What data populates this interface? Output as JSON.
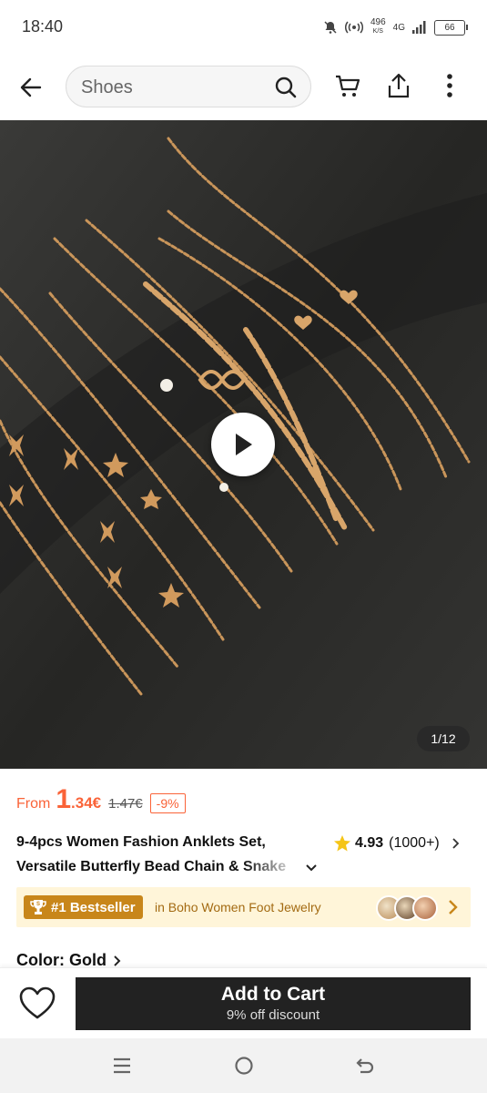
{
  "status_bar": {
    "time": "18:40",
    "net_speed_value": "496",
    "net_speed_unit": "K/S",
    "network": "4G",
    "battery": "66"
  },
  "header": {
    "search_placeholder": "Shoes"
  },
  "gallery": {
    "counter": "1/12"
  },
  "price": {
    "from_label": "From",
    "integer": "1",
    "decimal": ".34€",
    "original": "1.47€",
    "discount": "-9%"
  },
  "product": {
    "title_line1": "9-4pcs Women Fashion Anklets Set,",
    "title_line2": "Versatile Butterfly Bead Chain & Snake",
    "rating": "4.93",
    "review_count": "(1000+)"
  },
  "bestseller": {
    "badge": "#1 Bestseller",
    "category": "in Boho Women Foot Jewelry"
  },
  "color": {
    "label": "Color: Gold"
  },
  "bottom_bar": {
    "add_to_cart": "Add to Cart",
    "discount_note": "9% off discount"
  },
  "colors": {
    "accent": "#fa6338",
    "bestseller_bg": "#fff5d9",
    "bestseller_badge": "#c8861a",
    "cart_button": "#222222"
  }
}
